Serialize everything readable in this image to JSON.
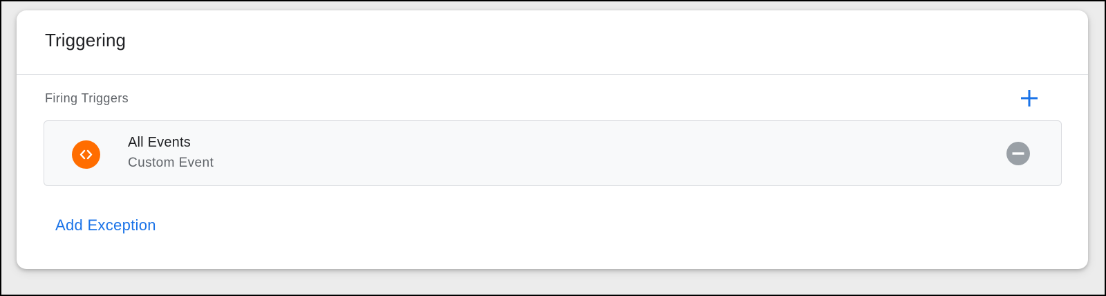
{
  "panel": {
    "title": "Triggering",
    "firing_triggers_label": "Firing Triggers",
    "add_icon": "plus-icon",
    "triggers": [
      {
        "name": "All Events",
        "type": "Custom Event",
        "icon": "custom-event-code-icon",
        "remove_icon": "remove-circle-icon"
      }
    ],
    "add_exception_label": "Add Exception"
  },
  "colors": {
    "accent": "#1a73e8",
    "trigger_icon_bg": "#ff6d00",
    "remove_icon": "#9aa0a6",
    "title_text": "#202124",
    "secondary_text": "#5f6368"
  }
}
